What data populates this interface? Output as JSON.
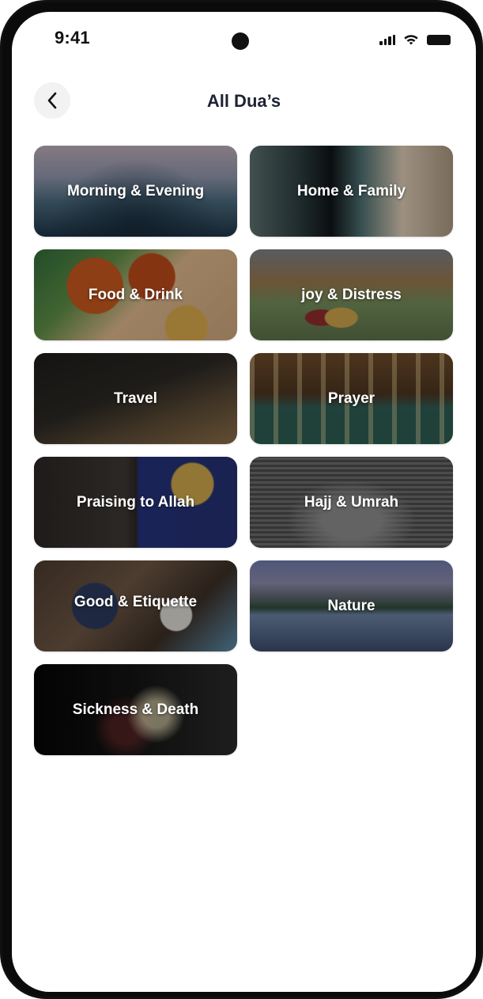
{
  "status_bar": {
    "time": "9:41"
  },
  "header": {
    "title": "All Dua’s"
  },
  "categories": [
    {
      "label": "Morning & Evening"
    },
    {
      "label": "Home & Family"
    },
    {
      "label": "Food & Drink"
    },
    {
      "label": "joy & Distress"
    },
    {
      "label": "Travel"
    },
    {
      "label": "Prayer"
    },
    {
      "label": "Praising to Allah"
    },
    {
      "label": "Hajj & Umrah"
    },
    {
      "label": "Good & Etiquette"
    },
    {
      "label": "Nature"
    },
    {
      "label": "Sickness & Death"
    }
  ],
  "icons": {
    "back": "chevron-left-icon",
    "signal": "cellular-signal-icon",
    "wifi": "wifi-icon",
    "battery": "battery-icon"
  },
  "colors": {
    "title": "#1e2233",
    "back_button_bg": "#f2f2f2",
    "label": "#ffffff"
  }
}
